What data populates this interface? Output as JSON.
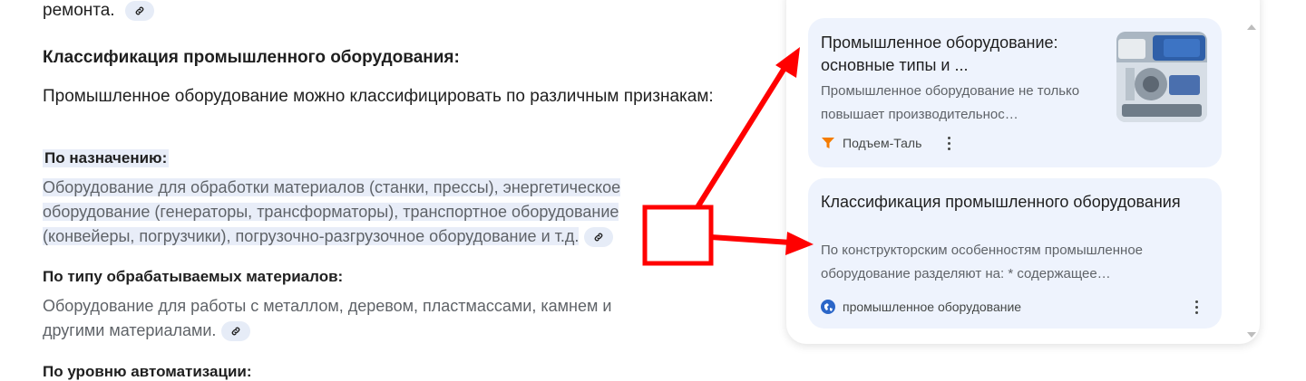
{
  "article": {
    "top_fragment": "ремонта.",
    "section_heading": "Классификация промышленного оборудования:",
    "intro": "Промышленное оборудование можно классифицировать по различным признакам:",
    "by_purpose_heading": "По назначению:",
    "by_purpose_line1": "Оборудование для обработки материалов (станки, прессы), энергетическое",
    "by_purpose_line2": "оборудование (генераторы, трансформаторы), транспортное оборудование",
    "by_purpose_line3": "(конвейеры, погрузчики), погрузочно-разгрузочное оборудование и т.д.",
    "by_material_heading": "По типу обрабатываемых материалов:",
    "by_material_text": "Оборудование для работы с металлом, деревом, пластмассами, камнем и другими материалами.",
    "by_automation_heading": "По уровню автоматизации:"
  },
  "sources": [
    {
      "title": "Промышленное оборудование: основные типы и ...",
      "snippet": "Промышленное оборудование не только повышает производительнос…",
      "site": "Подъем-Таль",
      "icon": "funnel-icon"
    },
    {
      "title": "Классификация промышленного оборудования",
      "snippet": "По конструкторским особенностям промышленное оборудование разделяют на: * содержащее…",
      "site": "промышленное оборудование",
      "icon": "globe-icon"
    }
  ],
  "colors": {
    "highlight": "#e8edf8",
    "card_bg": "#eef3fd",
    "annotation_red": "#ff0000"
  }
}
